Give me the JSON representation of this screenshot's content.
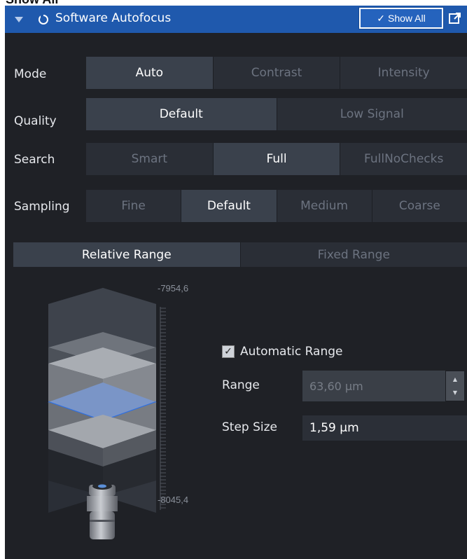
{
  "top_label": "Show All",
  "header": {
    "title": "Software Autofocus",
    "show_all_label": "Show All",
    "icons": [
      "collapse-arrow-icon",
      "refresh-circle-icon",
      "check-icon",
      "external-window-icon"
    ]
  },
  "mode": {
    "label": "Mode",
    "options": [
      "Auto",
      "Contrast",
      "Intensity"
    ],
    "selected": "Auto"
  },
  "quality": {
    "label": "Quality",
    "options": [
      "Default",
      "Low Signal"
    ],
    "selected": "Default"
  },
  "search": {
    "label": "Search",
    "options": [
      "Smart",
      "Full",
      "FullNoChecks"
    ],
    "selected": "Full"
  },
  "sampling": {
    "label": "Sampling",
    "options": [
      "Fine",
      "Default",
      "Medium",
      "Coarse"
    ],
    "selected": "Default"
  },
  "range_tabs": {
    "options": [
      "Relative Range",
      "Fixed Range"
    ],
    "selected": "Relative Range"
  },
  "scale": {
    "top": "-7954,6",
    "bottom": "-8045,4"
  },
  "automatic_range": {
    "label": "Automatic Range",
    "checked": true
  },
  "range": {
    "label": "Range",
    "value": "63,60 µm"
  },
  "step_size": {
    "label": "Step Size",
    "value": "1,59 µm"
  },
  "colors": {
    "header_bg": "#1f59ad",
    "panel_bg": "#1f2126",
    "selected_segment": "#3a414c",
    "focus_plane": "#2f6fe0"
  }
}
